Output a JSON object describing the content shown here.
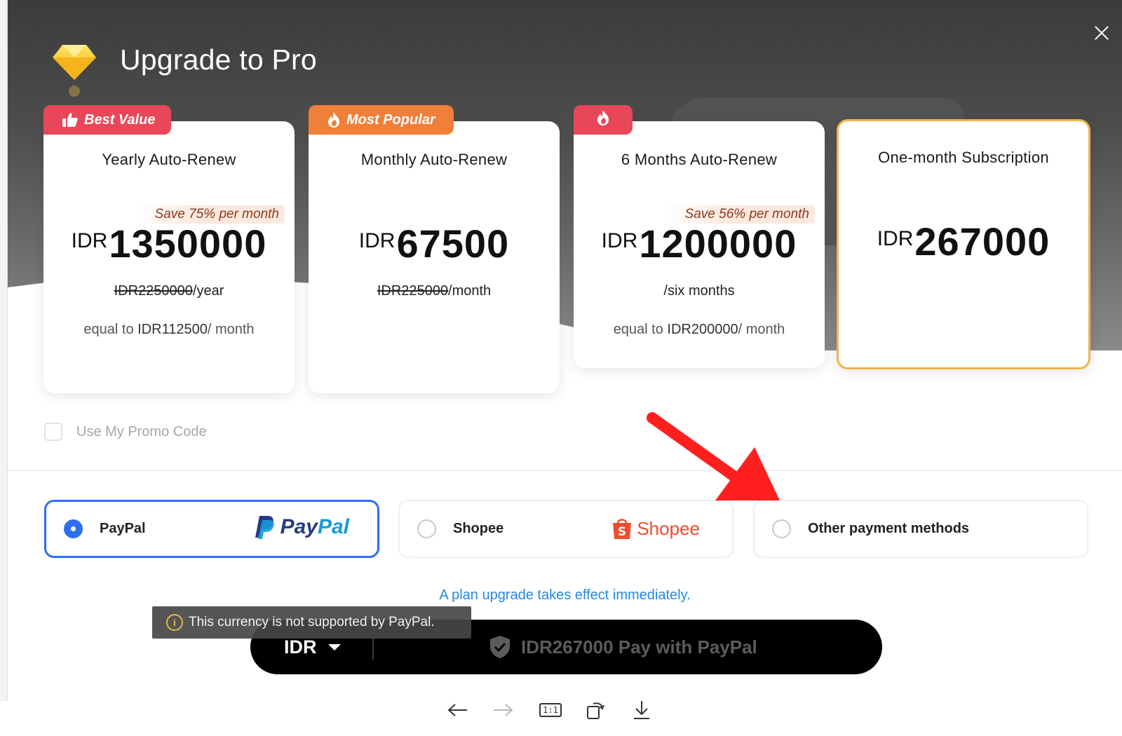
{
  "modal": {
    "title": "Upgrade to Pro",
    "close_icon": "close-icon"
  },
  "plans": [
    {
      "ribbon": "Best Value",
      "ribbon_icon": "thumbs-up-icon",
      "name": "Yearly Auto-Renew",
      "save": "Save 75% per month",
      "currency": "IDR",
      "price": "1350000",
      "original_price": "IDR2250000",
      "period": "/year",
      "equal_prefix": "equal to ",
      "equal_amount": "IDR112500",
      "equal_suffix": "/ month"
    },
    {
      "ribbon": "Most Popular",
      "ribbon_icon": "flame-icon",
      "name": "Monthly Auto-Renew",
      "currency": "IDR",
      "price": "67500",
      "original_price": "IDR225000",
      "period": "/month"
    },
    {
      "ribbon_icon": "flame-icon",
      "name": "6 Months Auto-Renew",
      "save": "Save 56% per month",
      "currency": "IDR",
      "price": "1200000",
      "period": "/six months",
      "equal_prefix": "equal to ",
      "equal_amount": "IDR200000",
      "equal_suffix": "/ month"
    },
    {
      "name": "One-month Subscription",
      "currency": "IDR",
      "price": "267000",
      "selected": true
    }
  ],
  "promo": {
    "label": "Use My Promo Code",
    "checked": false
  },
  "payment_methods": [
    {
      "name": "PayPal",
      "logo_text": "PayPal",
      "logo_icon": "paypal-logo-icon",
      "selected": true
    },
    {
      "name": "Shopee",
      "logo_text": "Shopee",
      "logo_icon": "shopee-bag-icon",
      "selected": false
    },
    {
      "name": "Other payment methods",
      "selected": false
    }
  ],
  "notice": "A plan upgrade takes effect immediately.",
  "tooltip": {
    "text": "This currency is not supported by PayPal.",
    "icon": "info-icon"
  },
  "pay_bar": {
    "currency": "IDR",
    "pay_label": "IDR267000 Pay with PayPal",
    "shield_icon": "shield-check-icon"
  },
  "viewer_toolbar": {
    "actual_size_label": "1:1",
    "icons": [
      "arrow-left-icon",
      "arrow-right-icon",
      "actual-size-icon",
      "rotate-icon",
      "download-icon"
    ]
  },
  "colors": {
    "accent_blue": "#2e6ff0",
    "ribbon_red": "#e8475a",
    "ribbon_orange": "#f07f3a",
    "selected_border": "#f0b44c",
    "notice_blue": "#1f88e5",
    "shopee_orange": "#ee4d2d",
    "annotation_arrow": "#ff1f1f"
  }
}
